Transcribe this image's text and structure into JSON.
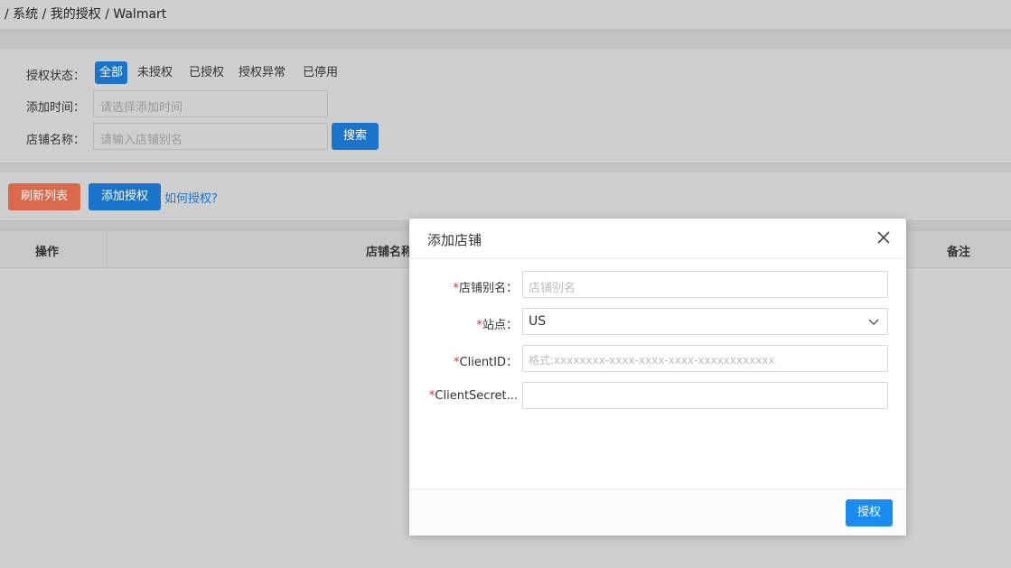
{
  "breadcrumb": {
    "text": "/ 系统 / 我的授权 / Walmart"
  },
  "filters": {
    "status_label": "授权状态：",
    "status_options": [
      "全部",
      "未授权",
      "已授权",
      "授权异常",
      "已停用"
    ],
    "time_label": "添加时间：",
    "time_placeholder": "请选择添加时间",
    "store_label": "店铺名称：",
    "store_placeholder": "请输入店铺别名",
    "search_label": "搜索"
  },
  "toolbar": {
    "refresh_label": "刷新列表",
    "add_label": "添加授权",
    "help_link": "如何授权?"
  },
  "table": {
    "headers": [
      "操作",
      "店铺名称",
      "备注"
    ]
  },
  "modal": {
    "title": "添加店铺",
    "fields": [
      {
        "required": "*",
        "label": "店铺别名：",
        "placeholder": "店铺别名"
      },
      {
        "required": "*",
        "label": "站点：",
        "value": "US"
      },
      {
        "required": "*",
        "label": "ClientID：",
        "placeholder": "格式:xxxxxxxx-xxxx-xxxx-xxxx-xxxxxxxxxxxx"
      },
      {
        "required": "*",
        "label": "ClientSecret...",
        "placeholder": ""
      }
    ],
    "submit_label": "授权"
  },
  "colors": {
    "primary": "#1a74c9",
    "refresh": "#d9694a",
    "required": "#e02c2c"
  },
  "icons": {
    "close": "close-icon",
    "dropdown": "chevron-down-icon"
  }
}
